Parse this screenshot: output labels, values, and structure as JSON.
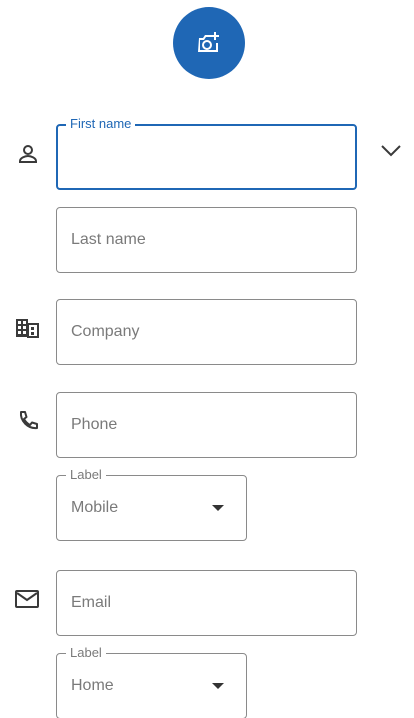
{
  "avatar": {
    "icon": "add-photo-icon",
    "color": "#1f67b5"
  },
  "name_section": {
    "first_name": {
      "label": "First name",
      "value": ""
    },
    "last_name": {
      "placeholder": "Last name"
    },
    "expand_icon": "chevron-down-icon"
  },
  "company": {
    "placeholder": "Company",
    "icon": "company-building-icon"
  },
  "phone": {
    "placeholder": "Phone",
    "icon": "phone-icon",
    "label_dropdown": {
      "label": "Label",
      "value": "Mobile"
    }
  },
  "email": {
    "placeholder": "Email",
    "icon": "email-icon",
    "label_dropdown": {
      "label": "Label",
      "value": "Home"
    }
  },
  "colors": {
    "accent": "#1f67b5",
    "border": "#8a8a8a",
    "hint": "#7a7a7a"
  }
}
